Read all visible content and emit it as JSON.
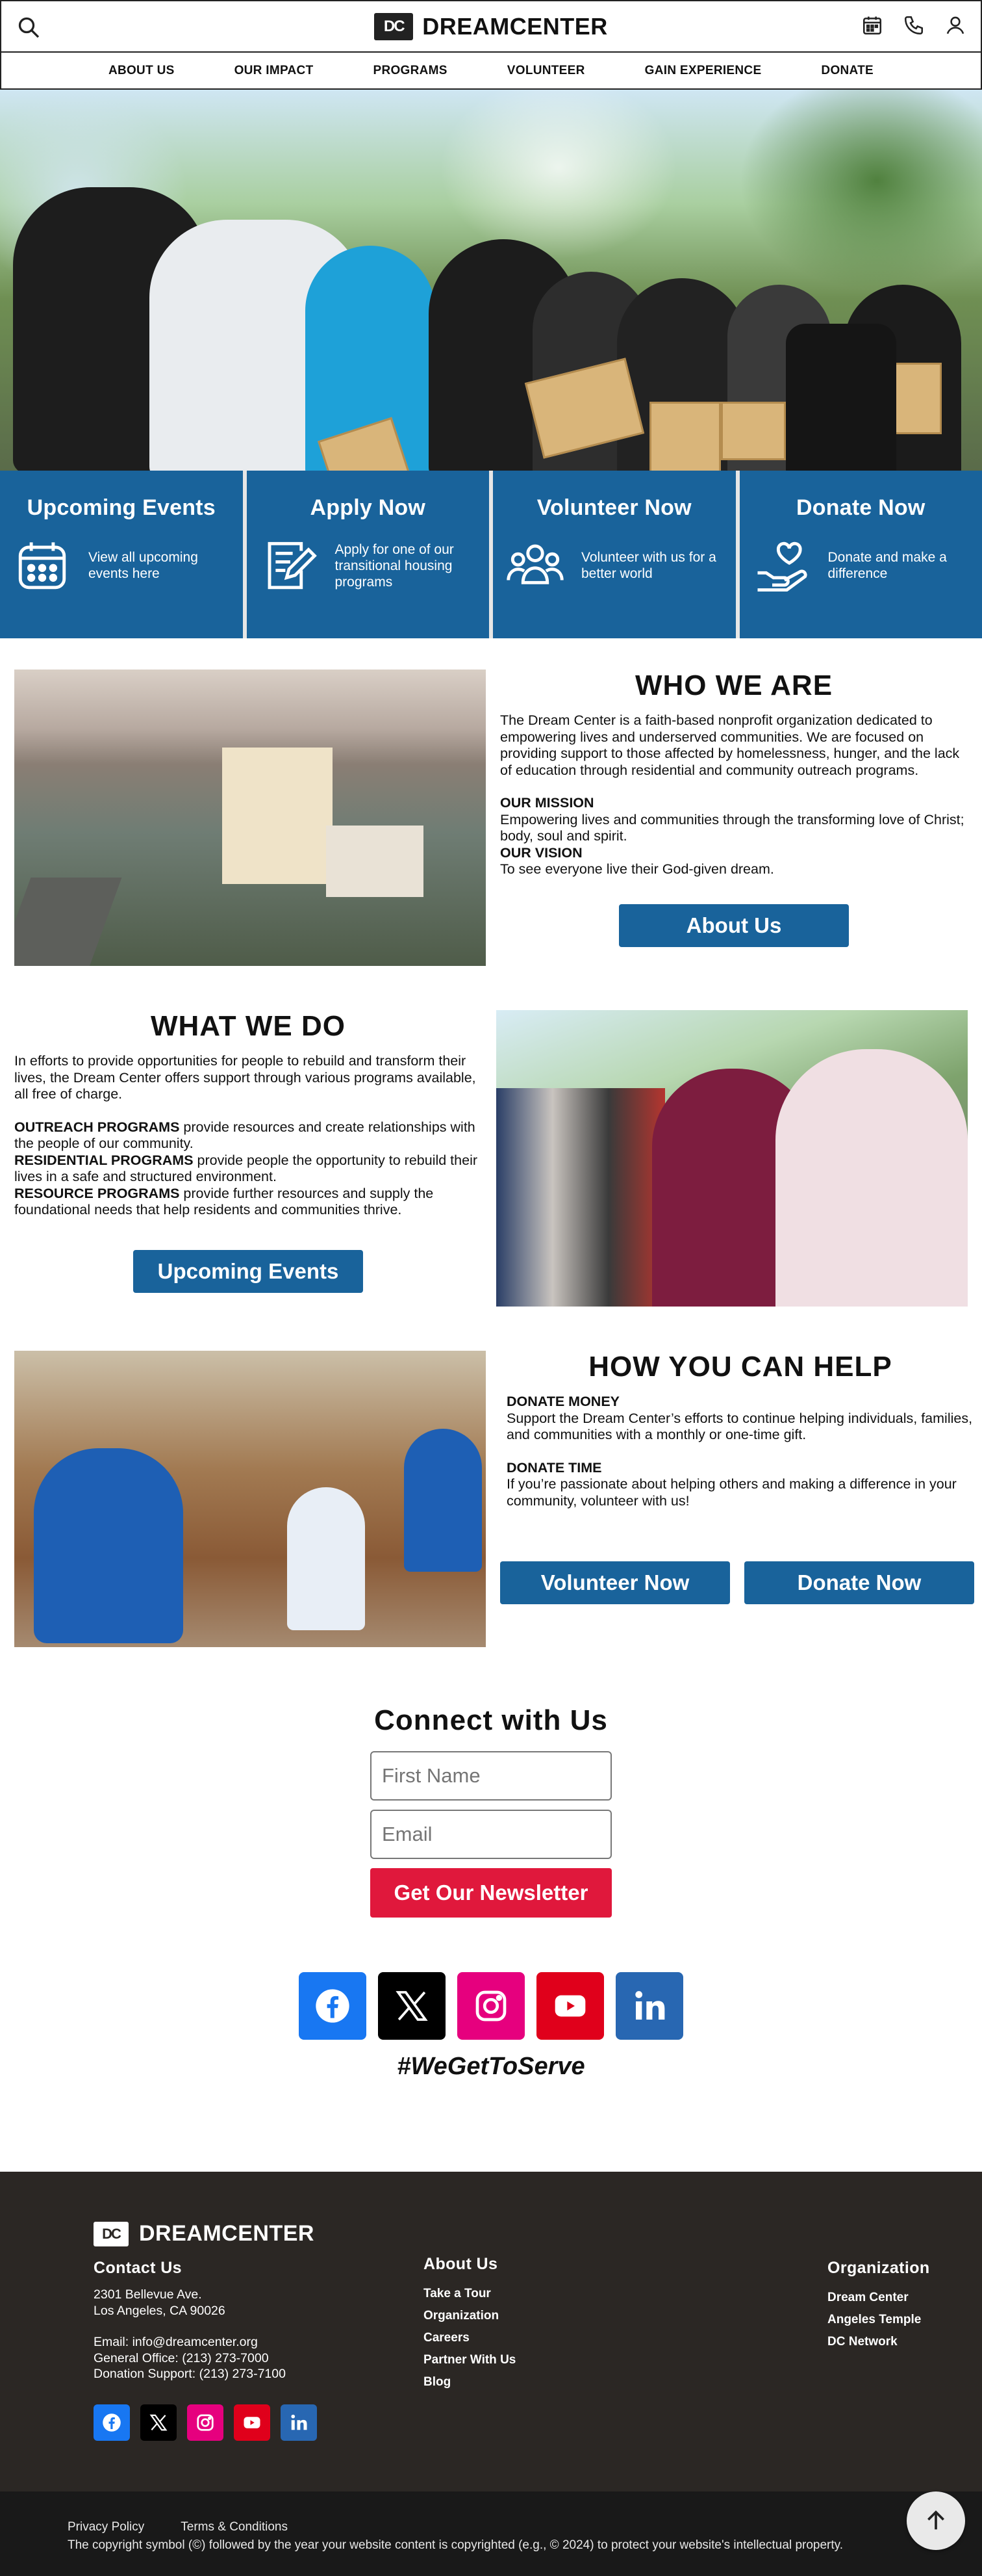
{
  "header": {
    "brand": "DREAMCENTER",
    "logo_mark": "DC",
    "icons": [
      "search-icon",
      "calendar-icon",
      "phone-icon",
      "user-icon"
    ]
  },
  "nav": [
    "ABOUT US",
    "OUR IMPACT",
    "PROGRAMS",
    "VOLUNTEER",
    "GAIN EXPERIENCE",
    "DONATE"
  ],
  "tiles": [
    {
      "title": "Upcoming Events",
      "text": "View all upcoming events here",
      "icon": "calendar-icon"
    },
    {
      "title": "Apply Now",
      "text": "Apply for one of our transitional housing programs",
      "icon": "application-icon"
    },
    {
      "title": "Volunteer Now",
      "text": "Volunteer with us for a better world",
      "icon": "people-icon"
    },
    {
      "title": "Donate Now",
      "text": "Donate and make a difference",
      "icon": "heart-hand-icon"
    }
  ],
  "who": {
    "title": "WHO WE ARE",
    "intro": "The Dream Center is a faith-based nonprofit organization dedicated to empowering lives and underserved communities. We are focused on providing support to those affected by homelessness, hunger, and the lack of education through residential and community outreach programs.",
    "mission_label": "OUR MISSION",
    "mission": "Empowering lives and communities through the transforming love of Christ; body, soul and spirit.",
    "vision_label": "OUR VISION",
    "vision": "To see everyone live their God-given dream.",
    "button": "About Us"
  },
  "what": {
    "title": "WHAT WE DO",
    "intro": "In efforts to provide opportunities for people to rebuild and transform their lives, the Dream Center offers support through various programs available, all free of charge.",
    "outreach_label": "OUTREACH PROGRAMS",
    "outreach": " provide resources and create relationships with the people of our community.",
    "residential_label": "RESIDENTIAL PROGRAMS",
    "residential": " provide people the opportunity to rebuild their lives in a safe and structured environment.",
    "resource_label": "RESOURCE PROGRAMS",
    "resource": " provide further resources and supply the foundational needs that help residents and communities thrive.",
    "button": "Upcoming Events"
  },
  "help": {
    "title": "HOW YOU CAN HELP",
    "money_label": "DONATE MONEY",
    "money": "Support the Dream Center’s efforts to continue helping individuals, families, and communities with a monthly or one-time gift.",
    "time_label": "DONATE TIME",
    "time": "If you’re passionate about helping others and making a difference in your community, volunteer with us!",
    "volunteer_button": "Volunteer Now",
    "donate_button": "Donate Now"
  },
  "connect": {
    "title": "Connect with Us",
    "first_name_placeholder": "First Name",
    "email_placeholder": "Email",
    "button": "Get Our Newsletter",
    "hashtag": "#WeGetToServe",
    "colors": {
      "facebook": "#1877f2",
      "x": "#000000",
      "instagram": "#e6007e",
      "youtube": "#e0001b",
      "linkedin": "#2867b2"
    }
  },
  "footer": {
    "brand": "DREAMCENTER",
    "contact_title": "Contact Us",
    "address1": "2301 Bellevue Ave.",
    "address2": "Los Angeles, CA 90026",
    "email": "Email: info@dreamcenter.org",
    "office": "General Office: (213) 273-7000",
    "donation": "Donation Support: (213) 273-7100",
    "about_title": "About Us",
    "about_links": [
      "Take a Tour",
      "Organization",
      "Careers",
      "Partner With Us",
      "Blog"
    ],
    "org_title": "Organization",
    "org_links": [
      "Dream Center",
      "Angeles Temple",
      "DC Network"
    ]
  },
  "bottom": {
    "privacy": "Privacy Policy",
    "terms": "Terms & Conditions",
    "copyright": "The copyright symbol (©) followed by the year your website content is copyrighted (e.g., © 2024) to protect your website's intellectual property."
  }
}
